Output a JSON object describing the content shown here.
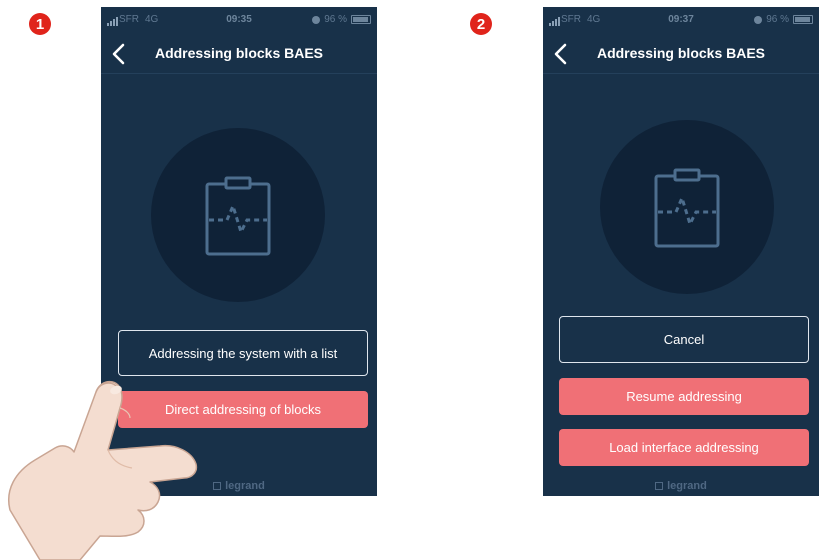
{
  "steps": [
    {
      "badge": "1",
      "status": {
        "carrier": "SFR",
        "network": "4G",
        "time": "09:35",
        "battery": "96 %"
      },
      "title": "Addressing blocks BAES",
      "buttons": [
        {
          "label": "Addressing the system with a list",
          "style": "outline"
        },
        {
          "label": "Direct addressing of blocks",
          "style": "solid"
        }
      ],
      "logo": "legrand"
    },
    {
      "badge": "2",
      "status": {
        "carrier": "SFR",
        "network": "4G",
        "time": "09:37",
        "battery": "96 %"
      },
      "title": "Addressing blocks BAES",
      "buttons": [
        {
          "label": "Cancel",
          "style": "outline"
        },
        {
          "label": "Resume addressing",
          "style": "solid"
        },
        {
          "label": "Load interface addressing",
          "style": "solid"
        }
      ],
      "logo": "legrand"
    }
  ],
  "icons": {
    "back": "chevron-left-icon",
    "hero": "clipboard-pulse-icon",
    "hand": "pointing-hand-icon"
  },
  "colors": {
    "screen_background": "#183149",
    "primary_button": "#f07076",
    "step_badge": "#e0241b"
  }
}
